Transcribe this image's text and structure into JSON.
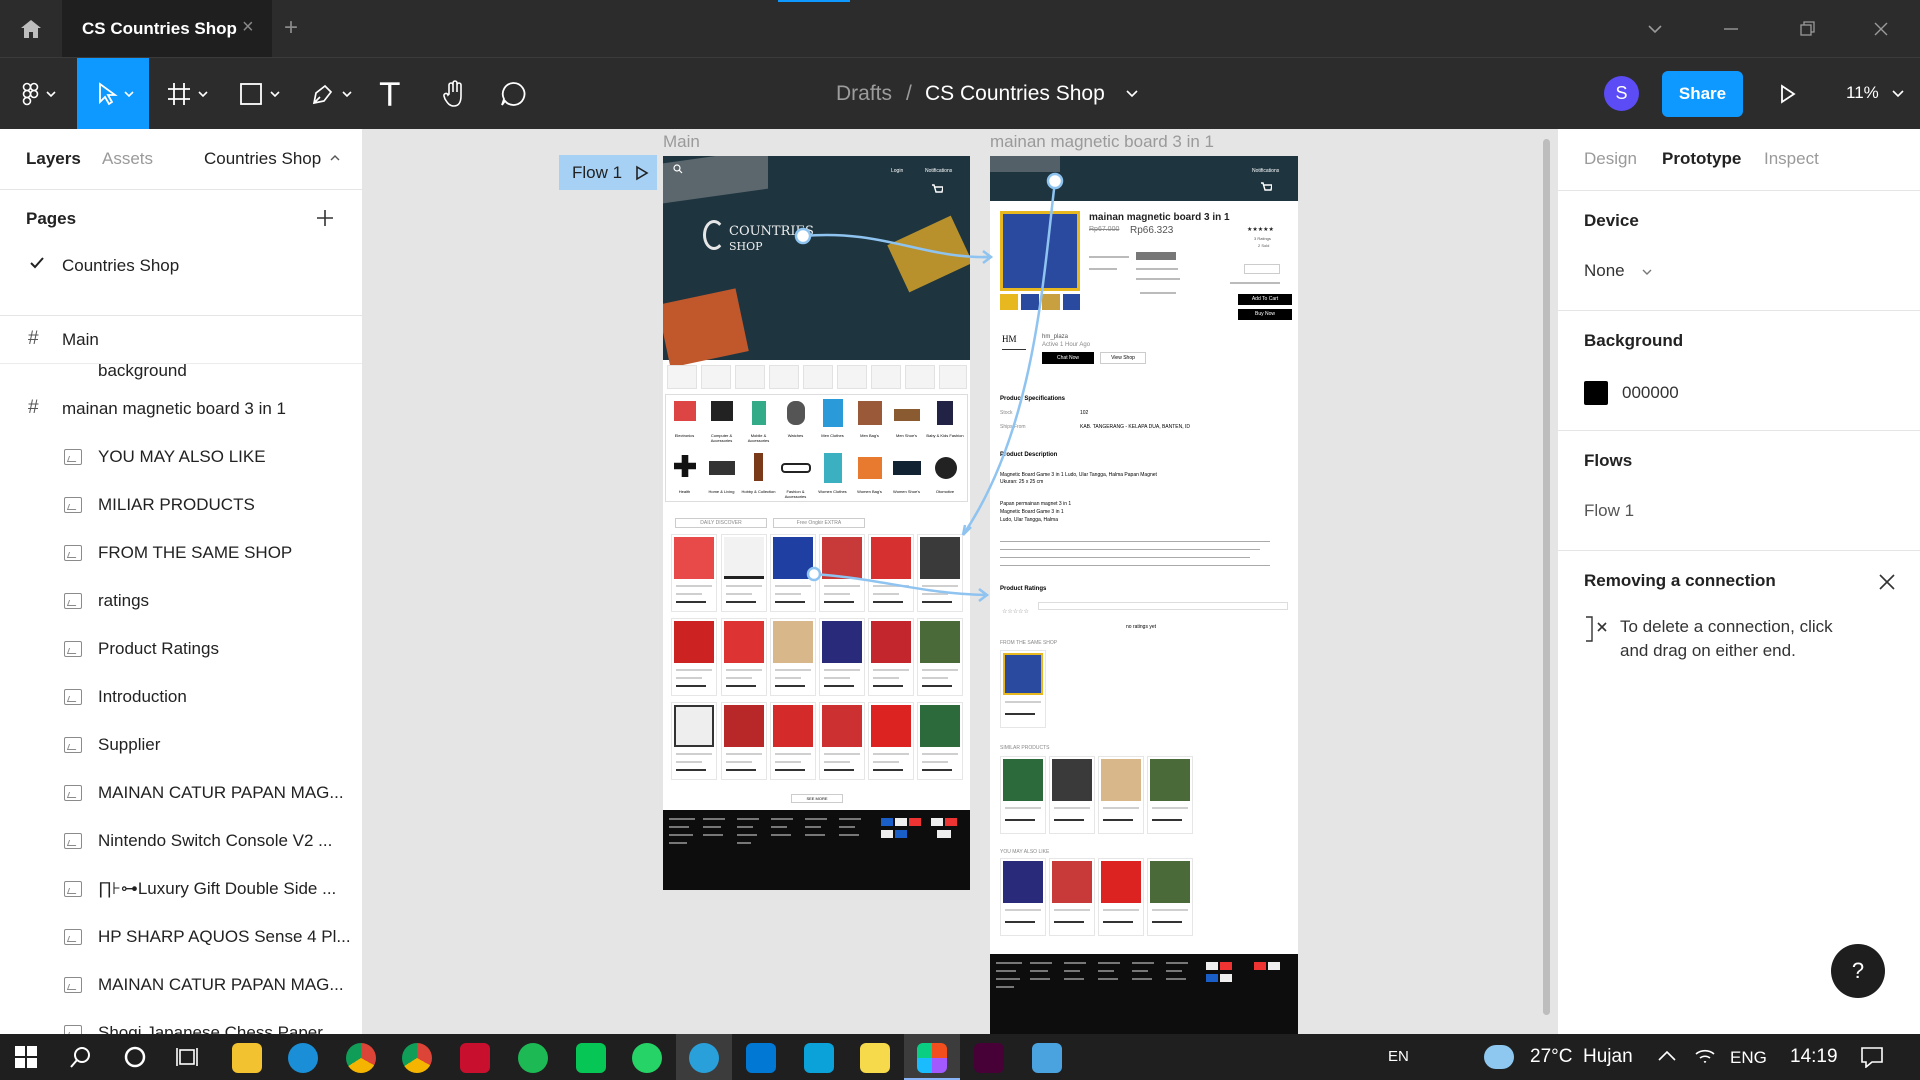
{
  "titlebar": {
    "tab_title": "CS Countries Shop",
    "tab_close": "×",
    "new_tab": "+"
  },
  "toolbar": {
    "breadcrumb_parent": "Drafts",
    "breadcrumb_sep": "/",
    "file_name": "CS Countries Shop",
    "avatar_letter": "S",
    "share_label": "Share",
    "zoom": "11%",
    "text_tool": "T"
  },
  "left_panel": {
    "tabs": [
      "Layers",
      "Assets"
    ],
    "page_selector": "Countries Shop",
    "pages_title": "Pages",
    "pages": [
      {
        "label": "Countries Shop",
        "selected": true
      }
    ],
    "frames": [
      {
        "label": "Main",
        "children": [
          "background"
        ]
      },
      {
        "label": "mainan magnetic board 3 in 1",
        "children": [
          "YOU MAY ALSO LIKE",
          "MILIAR PRODUCTS",
          "FROM THE SAME SHOP",
          "ratings",
          "Product Ratings",
          "Introduction",
          "Supplier",
          "MAINAN CATUR PAPAN MAG...",
          "Nintendo Switch Console V2 ...",
          "∏⊦⊶Luxury Gift Double Side ...",
          "HP SHARP AQUOS Sense 4 Pl...",
          "MAINAN CATUR PAPAN MAG...",
          "Shogi Japanese Chess Paper..."
        ]
      }
    ]
  },
  "canvas": {
    "flow_label": "Flow 1",
    "frame1_label": "Main",
    "frame2_label": "mainan magnetic board 3 in 1",
    "logo_line1": "COUNTRIES",
    "logo_line2": "SHOP",
    "product_title": "mainan magnetic board 3 in 1",
    "old_price": "Rp67.000",
    "price": "Rp66.323",
    "ratings_count": "3 Ratings",
    "sold": "2 Sold",
    "add_to_cart": "Add To Cart",
    "buy_now": "Buy Now",
    "shop_name": "hm_plaza",
    "shop_active": "Active 1 Hour Ago",
    "chat_now": "Chat Now",
    "view_shop": "View Shop",
    "spec_title": "Product Specifications",
    "stock_label": "Stock",
    "stock_value": "102",
    "ships_from_label": "Ships From",
    "ships_from_value": "KAB. TANGERANG - KELAPA DUA, BANTEN, ID",
    "desc_title": "Product Description",
    "desc_lines": [
      "Magnetic Board Game 3 in 1 Ludo, Ular Tangga, Halma Papan Magnet",
      "Ukuran: 25 x 25 cm",
      "Papan permainan magnet 3 in 1",
      "Magnetic Board Game 3 in 1",
      "Ludo, Ular Tangga, Halma"
    ],
    "ratings_title": "Product Ratings",
    "no_ratings": "no ratings yet",
    "same_shop_title": "FROM THE SAME SHOP",
    "similar_title": "SIMILAR PRODUCTS",
    "also_like_title": "YOU MAY ALSO LIKE",
    "daily_discover": "DAILY DISCOVER",
    "free_ongkir": "Free Ongkir EXTRA",
    "see_more": "SEE MORE",
    "notifications": "Notifications",
    "login": "Login",
    "categories": [
      "Electronics",
      "Computer & Accessories",
      "Mobile & Accessories",
      "Watches",
      "Men Clothes",
      "Men Bag's",
      "Men Shoe's",
      "Baby & Kids Fashion",
      "Health",
      "Home & Living",
      "Hobby & Collection",
      "Fashion & Accessories",
      "Women Clothes",
      "Women Bag's",
      "Women Shoe's",
      "Otomotive"
    ]
  },
  "right_panel": {
    "tabs": [
      "Design",
      "Prototype",
      "Inspect"
    ],
    "active_tab": "Prototype",
    "device_title": "Device",
    "device_value": "None",
    "background_title": "Background",
    "background_value": "000000",
    "background_color": "#000000",
    "flows_title": "Flows",
    "flow_item": "Flow 1",
    "hint_title": "Removing a connection",
    "hint_text": "To delete a connection, click and drag on either end.",
    "help": "?"
  },
  "taskbar": {
    "lang_left": "EN",
    "weather": "27°C  Hujan",
    "lang": "ENG",
    "time": "14:19"
  },
  "colors": {
    "accent": "#0d99ff",
    "toolbar_bg": "#2c2c2c",
    "flow_connector": "#8fc3f0",
    "avatar": "#5b4cf5"
  }
}
